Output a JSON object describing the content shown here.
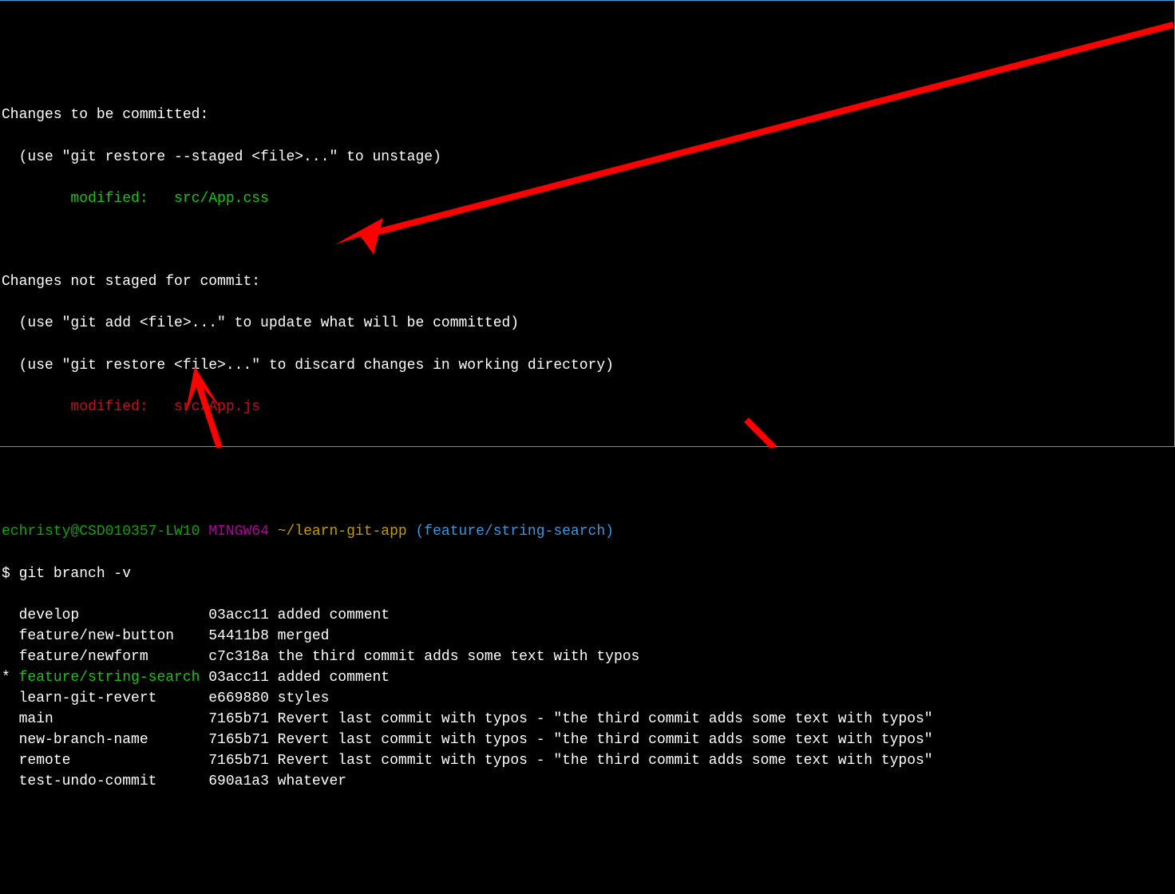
{
  "status": {
    "staged_header": "Changes to be committed:",
    "staged_hint": "  (use \"git restore --staged <file>...\" to unstage)",
    "staged_file": "        modified:   src/App.css",
    "unstaged_header": "Changes not staged for commit:",
    "unstaged_hint1": "  (use \"git add <file>...\" to update what will be committed)",
    "unstaged_hint2": "  (use \"git restore <file>...\" to discard changes in working directory)",
    "unstaged_file": "        modified:   src/App.js"
  },
  "prompt": {
    "user": "echristy",
    "host": "@CSD010357-LW10",
    "env": " MINGW64",
    "path": " ~/learn-git-app",
    "branch": " (feature/string-search)",
    "symbol": "$ ",
    "command": "git branch -v"
  },
  "branches": [
    {
      "marker": "  ",
      "name": "develop              ",
      "hash": " 03acc11",
      "msg": " added comment",
      "current": false
    },
    {
      "marker": "  ",
      "name": "feature/new-button   ",
      "hash": " 54411b8",
      "msg": " merged",
      "current": false
    },
    {
      "marker": "  ",
      "name": "feature/newform      ",
      "hash": " c7c318a",
      "msg": " the third commit adds some text with typos",
      "current": false
    },
    {
      "marker": "* ",
      "name": "feature/string-search",
      "hash": " 03acc11",
      "msg": " added comment",
      "current": true
    },
    {
      "marker": "  ",
      "name": "learn-git-revert     ",
      "hash": " e669880",
      "msg": " styles",
      "current": false
    },
    {
      "marker": "  ",
      "name": "main                 ",
      "hash": " 7165b71",
      "msg": " Revert last commit with typos - \"the third commit adds some text with typos\"",
      "current": false
    },
    {
      "marker": "  ",
      "name": "new-branch-name      ",
      "hash": " 7165b71",
      "msg": " Revert last commit with typos - \"the third commit adds some text with typos\"",
      "current": false
    },
    {
      "marker": "  ",
      "name": "remote               ",
      "hash": " 7165b71",
      "msg": " Revert last commit with typos - \"the third commit adds some text with typos\"",
      "current": false
    },
    {
      "marker": "  ",
      "name": "test-undo-commit     ",
      "hash": " 690a1a3",
      "msg": " whatever",
      "current": false
    }
  ],
  "colors": {
    "white": "#ffffff",
    "green": "#13a10e",
    "red": "#c50f1f",
    "magenta": "#b4009e",
    "cyan": "#3a96dd",
    "yellow": "#c19c00",
    "arrow": "#ff0000"
  }
}
